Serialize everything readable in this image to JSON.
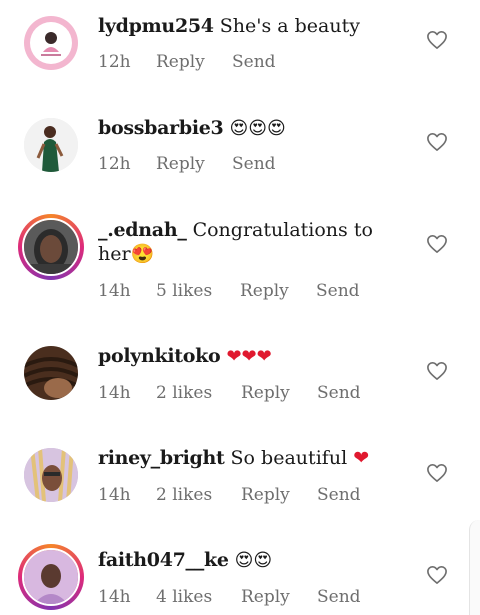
{
  "comments": [
    {
      "username": "lydpmu254",
      "text": "She's a beauty",
      "time": "12h",
      "likes": "",
      "reply_label": "Reply",
      "send_label": "Send",
      "avatar_icon": "pink-logo-avatar",
      "story_ring": false
    },
    {
      "username": "bossbarbie3",
      "text": "😍😍😍",
      "time": "12h",
      "likes": "",
      "reply_label": "Reply",
      "send_label": "Send",
      "avatar_icon": "woman-green-dress-avatar",
      "story_ring": false
    },
    {
      "username": "_.ednah_",
      "text": "Congratulations to her😍",
      "time": "14h",
      "likes": "5 likes",
      "reply_label": "Reply",
      "send_label": "Send",
      "avatar_icon": "woman-portrait-avatar",
      "story_ring": true
    },
    {
      "username": "polynkitoko",
      "text": "❤❤❤",
      "time": "14h",
      "likes": "2 likes",
      "reply_label": "Reply",
      "send_label": "Send",
      "avatar_icon": "braids-avatar",
      "story_ring": false
    },
    {
      "username": "riney_bright",
      "text": "So beautiful ❤",
      "time": "14h",
      "likes": "2 likes",
      "reply_label": "Reply",
      "send_label": "Send",
      "avatar_icon": "woman-braids-avatar",
      "story_ring": false
    },
    {
      "username": "faith047__ke",
      "text": "😍😍",
      "time": "14h",
      "likes": "4 likes",
      "reply_label": "Reply",
      "send_label": "Send",
      "avatar_icon": "woman-purple-avatar",
      "story_ring": true
    }
  ],
  "colors": {
    "meta_text": "#6e6e6e",
    "username": "#1a1a1a",
    "heart_red": "#e0192f",
    "like_outline": "#6e6e6e"
  },
  "icons": {
    "like": "heart-outline-icon"
  }
}
